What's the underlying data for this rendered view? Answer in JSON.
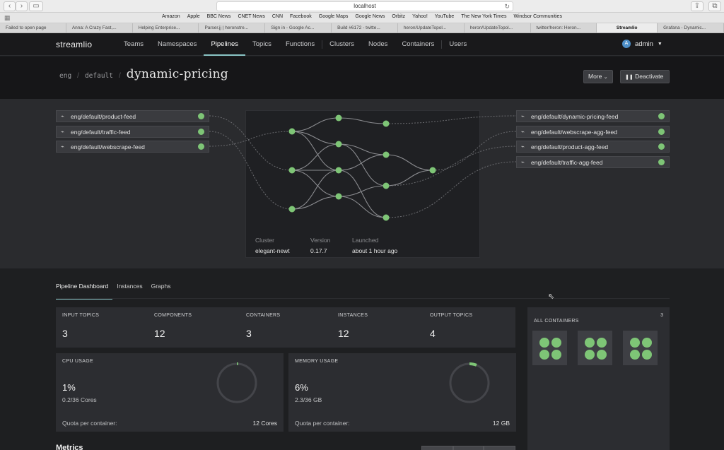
{
  "browser": {
    "url": "localhost",
    "favorites": [
      "Amazon",
      "Apple",
      "BBC News",
      "CNET News",
      "CNN",
      "Facebook",
      "Google Maps",
      "Google News",
      "Orbitz",
      "Yahoo!",
      "YouTube",
      "The New York Times",
      "Windsor Communities"
    ],
    "tabs": [
      {
        "title": "Failed to open page",
        "active": false
      },
      {
        "title": "Anna: A Crazy Fast,...",
        "active": false
      },
      {
        "title": "Helping Enterprise...",
        "active": false
      },
      {
        "title": "Parser.jj | heronstre...",
        "active": false
      },
      {
        "title": "Sign in - Google Ac...",
        "active": false
      },
      {
        "title": "Build #6172 - twitte...",
        "active": false
      },
      {
        "title": "heron/UpdateTopol...",
        "active": false
      },
      {
        "title": "heron/UpdateTopol...",
        "active": false
      },
      {
        "title": "twitter/heron: Heron...",
        "active": false
      },
      {
        "title": "Streamlio",
        "active": true
      },
      {
        "title": "Grafana - Dynamic...",
        "active": false
      }
    ]
  },
  "nav": {
    "logo": "streamlio",
    "links": [
      "Teams",
      "Namespaces",
      "Pipelines",
      "Topics",
      "Functions",
      "Clusters",
      "Nodes",
      "Containers",
      "Users"
    ],
    "active": "Pipelines",
    "user_initial": "A",
    "user_name": "admin"
  },
  "header": {
    "breadcrumb": [
      "eng",
      "default"
    ],
    "title": "dynamic-pricing",
    "more_label": "More",
    "deactivate_label": "Deactivate"
  },
  "topology": {
    "inputs": [
      "eng/default/product-feed",
      "eng/default/traffic-feed",
      "eng/default/webscrape-feed"
    ],
    "outputs": [
      "eng/default/dynamic-pricing-feed",
      "eng/default/webscrape-agg-feed",
      "eng/default/product-agg-feed",
      "eng/default/traffic-agg-feed"
    ],
    "cluster_label": "Cluster",
    "cluster_value": "elegant-newt",
    "version_label": "Version",
    "version_value": "0.17.7",
    "launched_label": "Launched",
    "launched_value": "about 1 hour ago"
  },
  "dashboard": {
    "tabs": [
      "Pipeline Dashboard",
      "Instances",
      "Graphs"
    ],
    "active_tab": "Pipeline Dashboard",
    "stats": [
      {
        "label": "INPUT TOPICS",
        "value": "3"
      },
      {
        "label": "COMPONENTS",
        "value": "12"
      },
      {
        "label": "CONTAINERS",
        "value": "3"
      },
      {
        "label": "INSTANCES",
        "value": "12"
      },
      {
        "label": "OUTPUT TOPICS",
        "value": "4"
      }
    ],
    "cpu": {
      "label": "CPU USAGE",
      "percent": "1%",
      "detail": "0.2/36 Cores",
      "quota_label": "Quota per container:",
      "quota_value": "12 Cores",
      "fraction": 0.01
    },
    "memory": {
      "label": "MEMORY USAGE",
      "percent": "6%",
      "detail": "2.3/36 GB",
      "quota_label": "Quota per container:",
      "quota_value": "12 GB",
      "fraction": 0.06
    },
    "all_containers_label": "ALL CONTAINERS",
    "all_containers_count": "3",
    "metrics_label": "Metrics"
  },
  "colors": {
    "accent": "#8ac4c5",
    "node": "#7ec576",
    "avatar": "#4e8fc8"
  }
}
